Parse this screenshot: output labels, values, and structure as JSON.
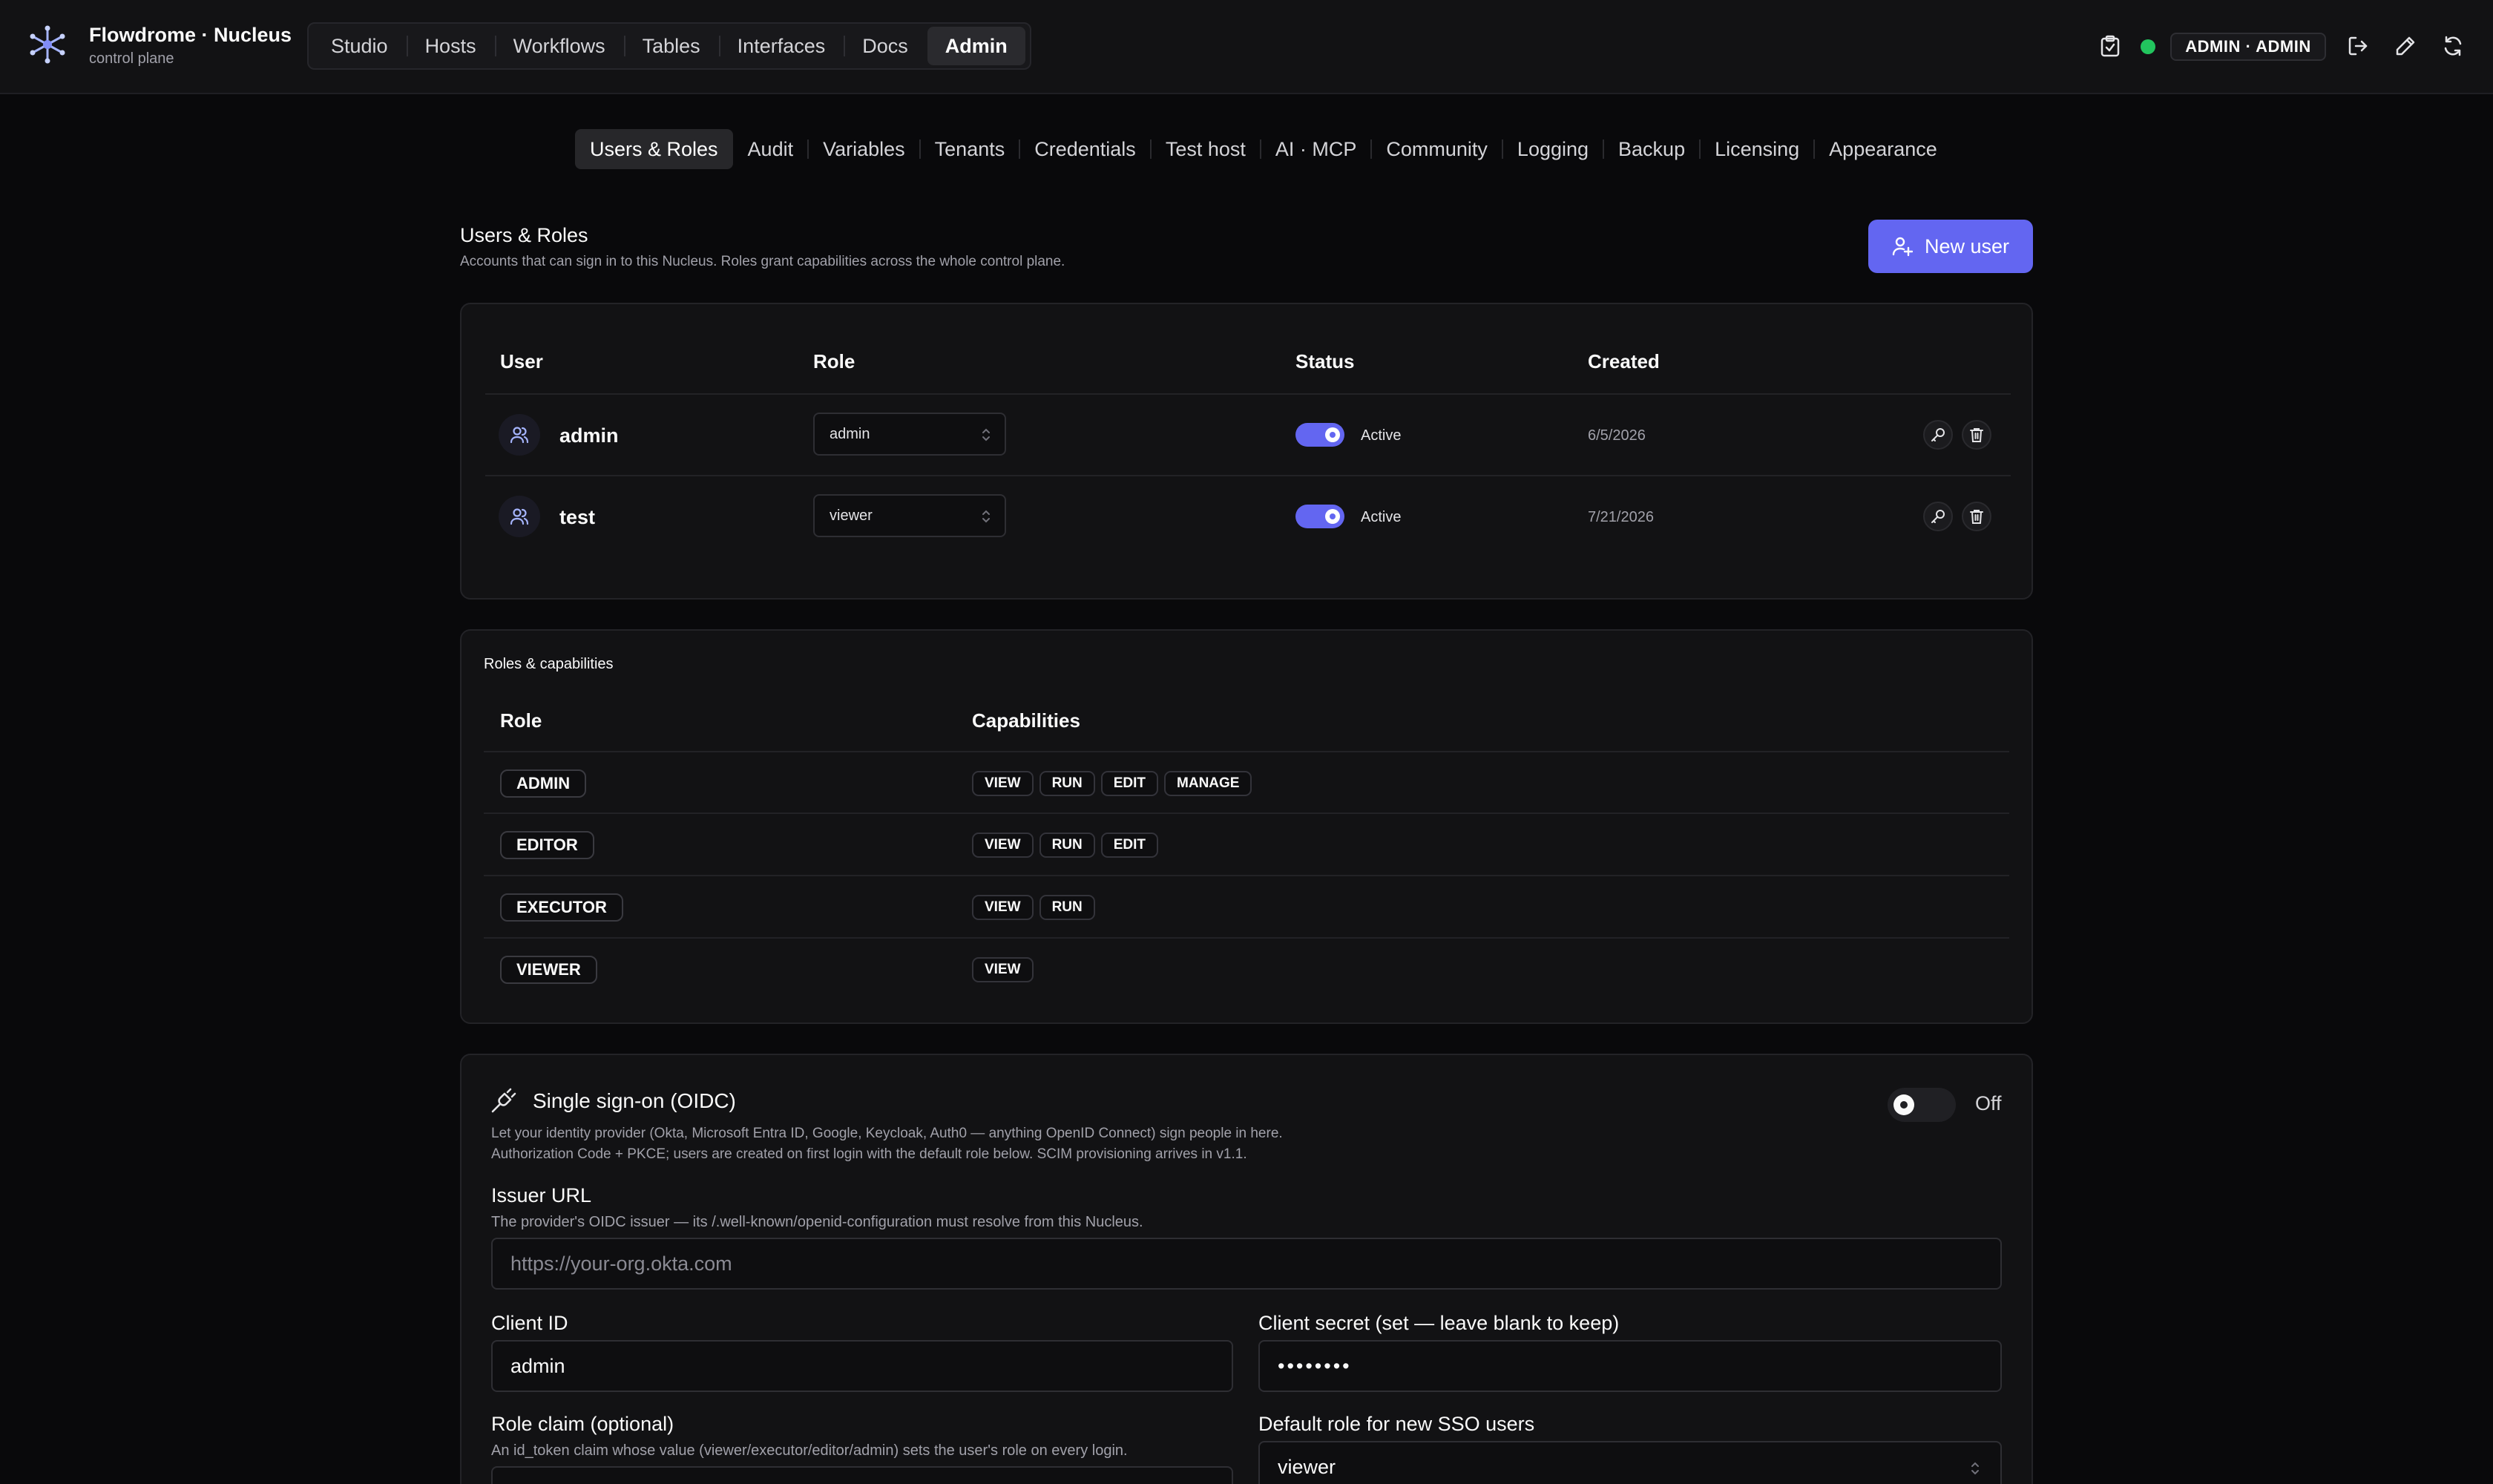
{
  "app": {
    "title": "Flowdrome · Nucleus",
    "subtitle": "control plane"
  },
  "nav": {
    "items": [
      "Studio",
      "Hosts",
      "Workflows",
      "Tables",
      "Interfaces",
      "Docs",
      "Admin"
    ],
    "active": "Admin"
  },
  "topbar": {
    "user_chip": "ADMIN · ADMIN",
    "status_color": "#22c55e"
  },
  "admin_tabs": {
    "items": [
      "Users & Roles",
      "Audit",
      "Variables",
      "Tenants",
      "Credentials",
      "Test host",
      "AI · MCP",
      "Community",
      "Logging",
      "Backup",
      "Licensing",
      "Appearance"
    ],
    "active": "Users & Roles"
  },
  "users_section": {
    "title": "Users & Roles",
    "description": "Accounts that can sign in to this Nucleus. Roles grant capabilities across the whole control plane.",
    "new_user_label": "New user",
    "columns": [
      "User",
      "Role",
      "Status",
      "Created"
    ],
    "rows": [
      {
        "name": "admin",
        "role": "admin",
        "status": "Active",
        "created": "6/5/2026"
      },
      {
        "name": "test",
        "role": "viewer",
        "status": "Active",
        "created": "7/21/2026"
      }
    ]
  },
  "roles_section": {
    "title": "Roles & capabilities",
    "columns": [
      "Role",
      "Capabilities"
    ],
    "rows": [
      {
        "role": "ADMIN",
        "caps": [
          "VIEW",
          "RUN",
          "EDIT",
          "MANAGE"
        ]
      },
      {
        "role": "EDITOR",
        "caps": [
          "VIEW",
          "RUN",
          "EDIT"
        ]
      },
      {
        "role": "EXECUTOR",
        "caps": [
          "VIEW",
          "RUN"
        ]
      },
      {
        "role": "VIEWER",
        "caps": [
          "VIEW"
        ]
      }
    ]
  },
  "sso": {
    "title": "Single sign-on (OIDC)",
    "toggle_label": "Off",
    "description_line1": "Let your identity provider (Okta, Microsoft Entra ID, Google, Keycloak, Auth0 — anything OpenID Connect) sign people in here.",
    "description_line2": "Authorization Code + PKCE; users are created on first login with the default role below. SCIM provisioning arrives in v1.1.",
    "issuer": {
      "label": "Issuer URL",
      "help": "The provider's OIDC issuer — its /.well-known/openid-configuration must resolve from this Nucleus.",
      "placeholder": "https://your-org.okta.com",
      "value": ""
    },
    "client_id": {
      "label": "Client ID",
      "value": "admin"
    },
    "client_secret": {
      "label": "Client secret (set — leave blank to keep)",
      "value": "••••••••"
    },
    "role_claim": {
      "label": "Role claim (optional)",
      "help": "An id_token claim whose value (viewer/executor/editor/admin) sets the user's role on every login."
    },
    "default_role": {
      "label": "Default role for new SSO users",
      "value": "viewer"
    }
  },
  "colors": {
    "accent": "#6366f1",
    "background": "#09090b",
    "card": "#121214"
  }
}
